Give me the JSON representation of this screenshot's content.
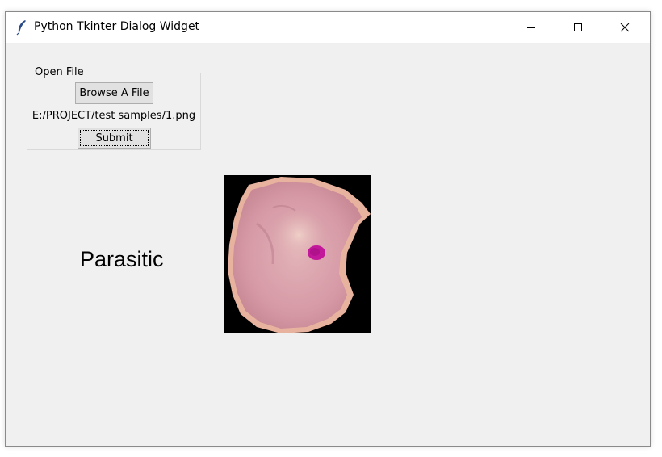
{
  "window": {
    "title": "Python Tkinter Dialog Widget",
    "controls": {
      "minimize": "minimize-icon",
      "maximize": "maximize-icon",
      "close": "close-icon"
    }
  },
  "open_file": {
    "frame_label": "Open File",
    "browse_label": "Browse A File",
    "selected_path": "E:/PROJECT/test samples/1.png",
    "submit_label": "Submit"
  },
  "result": {
    "label": "Parasitic"
  },
  "image": {
    "subject": "blood-cell-image",
    "background": "#000000",
    "cell_color": "#d49aa6",
    "stain_color": "#c2189a"
  }
}
